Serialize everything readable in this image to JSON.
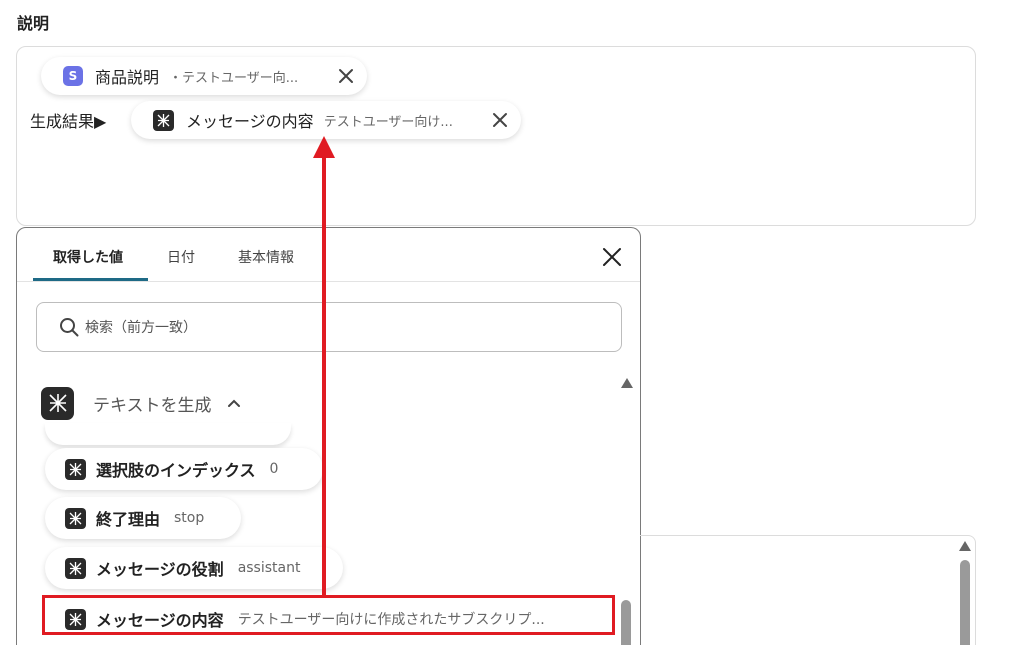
{
  "field": {
    "label": "説明"
  },
  "description": {
    "pill_1": {
      "title": "商品説明",
      "subtitle": "・テストユーザー向...",
      "badge": "S"
    },
    "result_label": "生成結果▶",
    "pill_2": {
      "title": "メッセージの内容",
      "subtitle": "テストユーザー向け..."
    }
  },
  "panel": {
    "tabs": [
      {
        "label": "取得した値"
      },
      {
        "label": "日付"
      },
      {
        "label": "基本情報"
      }
    ],
    "search": {
      "placeholder": "検索（前方一致）"
    },
    "group": {
      "title": "テキストを生成"
    },
    "items": [
      {
        "title": "選択肢のインデックス",
        "value": "0"
      },
      {
        "title": "終了理由",
        "value": "stop"
      },
      {
        "title": "メッセージの役割",
        "value": "assistant"
      },
      {
        "title": "メッセージの内容",
        "value": "テストユーザー向けに作成されたサブスクリプ..."
      }
    ]
  },
  "colors": {
    "accent_tab": "#1e6a86",
    "annotation_red": "#e01b22",
    "s_badge": "#6b72e6",
    "ai_badge": "#2a2a2a"
  },
  "icons": [
    "s-badge-icon",
    "ai-app-icon",
    "close-icon",
    "search-icon",
    "chevron-up-icon",
    "scroll-up-arrow-icon"
  ]
}
